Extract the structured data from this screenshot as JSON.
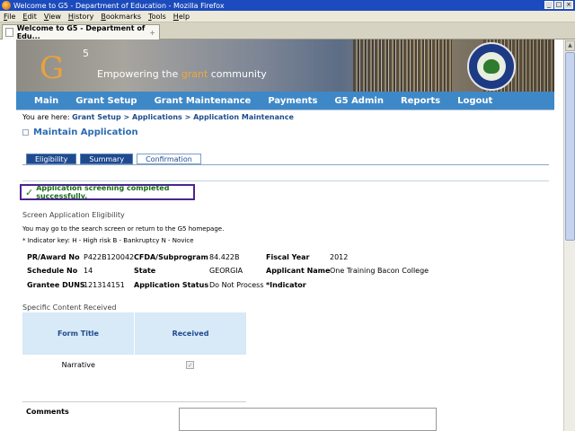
{
  "window": {
    "title": "Welcome to G5 - Department of Education - Mozilla Firefox"
  },
  "menu": [
    "File",
    "Edit",
    "View",
    "History",
    "Bookmarks",
    "Tools",
    "Help"
  ],
  "browser_tab": {
    "label": "Welcome to G5 - Department of Edu...",
    "close": "+"
  },
  "banner": {
    "logo_letter": "G",
    "logo_sup": "5",
    "tagline_pre": "Empowering the ",
    "tagline_accent": "grant",
    "tagline_post": " community"
  },
  "nav": [
    "Main",
    "Grant Setup",
    "Grant Maintenance",
    "Payments",
    "G5 Admin",
    "Reports",
    "Logout"
  ],
  "breadcrumb": {
    "prefix": "You are here: ",
    "path": "Grant Setup > Applications > Application Maintenance"
  },
  "page_title": "Maintain Application",
  "tabs": [
    {
      "label": "Eligibility",
      "active": false
    },
    {
      "label": "Summary",
      "active": false
    },
    {
      "label": "Confirmation",
      "active": true
    }
  ],
  "success_message": "Application screening completed successfully.",
  "section_title": "Screen Application Eligibility",
  "info_text": "You may go to the search screen or return to the G5 homepage.",
  "indicator_key": "* Indicator key: H - High risk B - Bankruptcy N - Novice",
  "details": {
    "pr_label": "PR/Award No",
    "pr_value": "P422B120042",
    "cfda_label": "CFDA/Subprogram",
    "cfda_value": "84.422B",
    "fy_label": "Fiscal Year",
    "fy_value": "2012",
    "sched_label": "Schedule No",
    "sched_value": "14",
    "state_label": "State",
    "state_value": "GEORGIA",
    "appname_label": "Applicant Name",
    "appname_value": "One Training Bacon College",
    "duns_label": "Grantee DUNS",
    "duns_value": "121314151",
    "status_label": "Application Status",
    "status_value": "Do Not Process",
    "indicator_label": "*Indicator"
  },
  "specific_content_title": "Specific Content Received",
  "forms_table": {
    "headers": [
      "Form Title",
      "Received"
    ],
    "rows": [
      {
        "title": "Narrative",
        "received": true
      }
    ]
  },
  "comments_label": "Comments",
  "colors": {
    "nav": "#3e88c8",
    "tab": "#1f4a8f",
    "success": "#1a6b1a",
    "highlight": "#4a2690"
  }
}
